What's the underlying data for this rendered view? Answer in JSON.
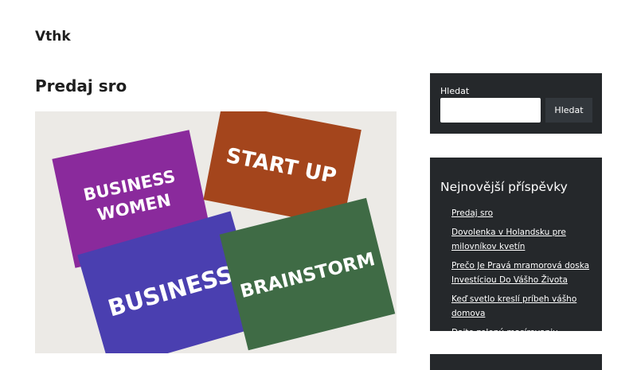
{
  "site": {
    "title": "Vthk"
  },
  "post": {
    "title": "Predaj sro",
    "image_cards": [
      "BUSINESS WOMEN",
      "START UP",
      "BUSINESS",
      "BRAINSTORM"
    ]
  },
  "sidebar": {
    "search": {
      "label": "Hledat",
      "button_label": "Hledat",
      "input_value": ""
    },
    "recent_posts": {
      "title": "Nejnovější příspěvky",
      "items": [
        "Predaj sro",
        "Dovolenka v Holandsku pre milovníkov kvetín",
        "Prečo Je Pravá mramorová doska Investíciou Do Vášho Života",
        "Keď svetlo kreslí príbeh vášho domova",
        "Dajte zelenú masírovaniu"
      ]
    }
  },
  "colors": {
    "widget_bg": "#25282b",
    "card_purple": "#8a2a9c",
    "card_orange": "#a4451c",
    "card_blue": "#4a3fb0",
    "card_green": "#3f6b45"
  }
}
